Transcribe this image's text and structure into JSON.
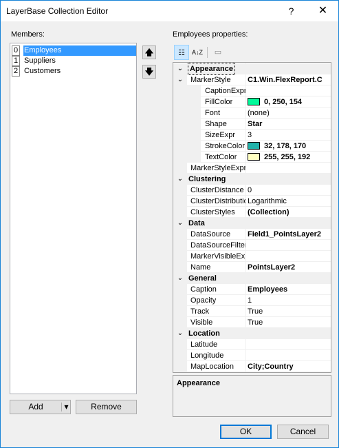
{
  "window": {
    "title": "LayerBase Collection Editor",
    "help_icon": "?",
    "close_icon": "✕"
  },
  "members": {
    "label": "Members:",
    "items": [
      {
        "index": "0",
        "name": "Employees",
        "selected": true
      },
      {
        "index": "1",
        "name": "Suppliers",
        "selected": false
      },
      {
        "index": "2",
        "name": "Customers",
        "selected": false
      }
    ],
    "move_up_icon": "🡅",
    "move_down_icon": "🡇",
    "add_label": "Add",
    "add_dropdown_icon": "▾",
    "remove_label": "Remove"
  },
  "properties": {
    "label": "Employees properties:",
    "toolbar": {
      "categorized_icon": "☷",
      "alphabetical_icon": "A↓Z",
      "property_pages_icon": "▭"
    },
    "categories": [
      {
        "name": "Appearance",
        "expanded": true,
        "rows": [
          {
            "name": "MarkerStyle",
            "value": "C1.Win.FlexReport.C",
            "bold": true,
            "expander": "⌄",
            "level": 0
          },
          {
            "name": "CaptionExpr",
            "value": "",
            "level": 1
          },
          {
            "name": "FillColor",
            "value": "0, 250, 154",
            "bold": true,
            "swatch": "#00fa9a",
            "level": 1
          },
          {
            "name": "Font",
            "value": "(none)",
            "level": 1
          },
          {
            "name": "Shape",
            "value": "Star",
            "bold": true,
            "level": 1
          },
          {
            "name": "SizeExpr",
            "value": "3",
            "level": 1
          },
          {
            "name": "StrokeColor",
            "value": "32, 178, 170",
            "bold": true,
            "swatch": "#20b2aa",
            "level": 1
          },
          {
            "name": "TextColor",
            "value": "255, 255, 192",
            "bold": true,
            "swatch": "#ffffc0",
            "level": 1
          },
          {
            "name": "MarkerStyleExpr",
            "value": "",
            "level": 0
          }
        ]
      },
      {
        "name": "Clustering",
        "expanded": true,
        "rows": [
          {
            "name": "ClusterDistance",
            "value": "0",
            "level": 0
          },
          {
            "name": "ClusterDistribution",
            "value": "Logarithmic",
            "level": 0
          },
          {
            "name": "ClusterStyles",
            "value": "(Collection)",
            "bold": true,
            "level": 0
          }
        ]
      },
      {
        "name": "Data",
        "expanded": true,
        "rows": [
          {
            "name": "DataSource",
            "value": "Field1_PointsLayer2",
            "bold": true,
            "level": 0
          },
          {
            "name": "DataSourceFilter",
            "value": "",
            "level": 0
          },
          {
            "name": "MarkerVisibleExpr",
            "value": "",
            "level": 0
          },
          {
            "name": "Name",
            "value": "PointsLayer2",
            "bold": true,
            "level": 0
          }
        ]
      },
      {
        "name": "General",
        "expanded": true,
        "rows": [
          {
            "name": "Caption",
            "value": "Employees",
            "bold": true,
            "level": 0
          },
          {
            "name": "Opacity",
            "value": "1",
            "level": 0
          },
          {
            "name": "Track",
            "value": "True",
            "level": 0
          },
          {
            "name": "Visible",
            "value": "True",
            "level": 0
          }
        ]
      },
      {
        "name": "Location",
        "expanded": true,
        "rows": [
          {
            "name": "Latitude",
            "value": "",
            "level": 0
          },
          {
            "name": "Longitude",
            "value": "",
            "level": 0
          },
          {
            "name": "MapLocation",
            "value": "City;Country",
            "bold": true,
            "level": 0
          }
        ]
      }
    ],
    "description_title": "Appearance"
  },
  "footer": {
    "ok_label": "OK",
    "cancel_label": "Cancel"
  }
}
